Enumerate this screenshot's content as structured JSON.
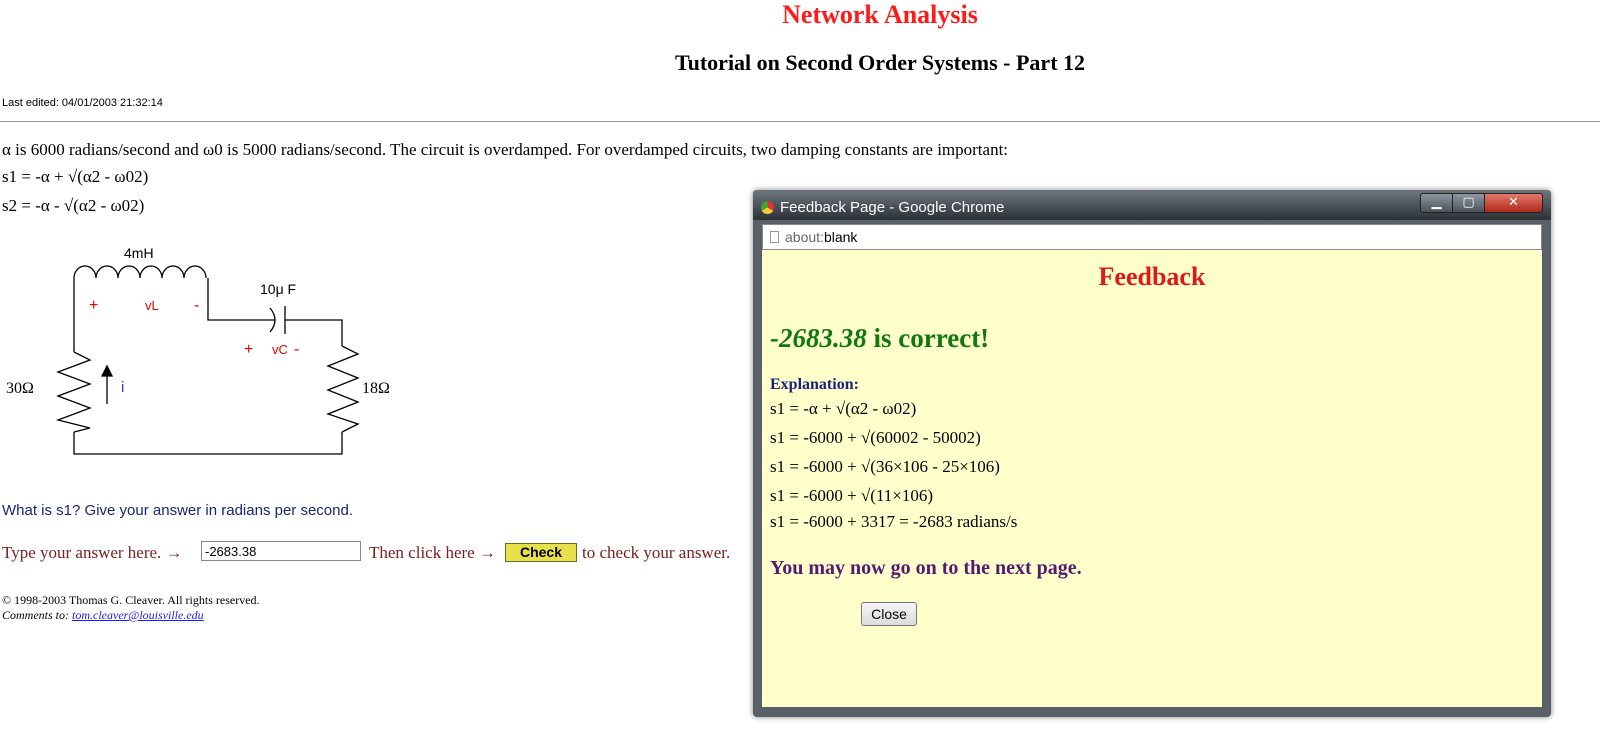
{
  "page": {
    "title": "Network Analysis",
    "subtitle": "Tutorial on Second Order Systems - Part 12",
    "last_edited": "Last edited: 04/01/2003 21:32:14",
    "intro": "α is 6000 radians/second and ω0 is 5000 radians/second. The circuit is overdamped. For overdamped circuits, two damping constants are important:",
    "s1_formula": "s1 = -α + √(α2 - ω02)",
    "s2_formula": "s2 = -α - √(α2 - ω02)",
    "circuit": {
      "inductor": "4mH",
      "capacitor": "10μ F",
      "left_resistor": "30Ω",
      "right_resistor": "18Ω",
      "vl_plus": "+",
      "vl_label": "vL",
      "vl_minus": "-",
      "vc_plus": "+",
      "vc_label": "vC",
      "vc_minus": "-",
      "current": "i"
    },
    "question": "What is s1? Give your answer in radians per second.",
    "answer_prompt": "Type your answer here. →",
    "answer_value": "-2683.38",
    "then_click": "Then click here →",
    "check_label": "Check",
    "after_check": "to check your answer.",
    "copyright": "© 1998-2003 Thomas G. Cleaver. All rights reserved.",
    "comments_label": "Comments to:",
    "comments_email": "tom.cleaver@louisville.edu"
  },
  "popup": {
    "window_title": "Feedback Page - Google Chrome",
    "url_scheme": "about:",
    "url_rest": "blank",
    "heading": "Feedback",
    "answer": "-2683.38",
    "correct_text": "is correct!",
    "explanation_label": "Explanation:",
    "steps": [
      "s1 = -α + √(α2 - ω02)",
      "s1 = -6000 + √(60002 - 50002)",
      "s1 = -6000 + √(36×106 - 25×106)",
      "s1 = -6000 + √(11×106)",
      "s1 = -6000 + 3317 = -2683 radians/s"
    ],
    "next_page": "You may now go on to the next page.",
    "close_label": "Close"
  }
}
